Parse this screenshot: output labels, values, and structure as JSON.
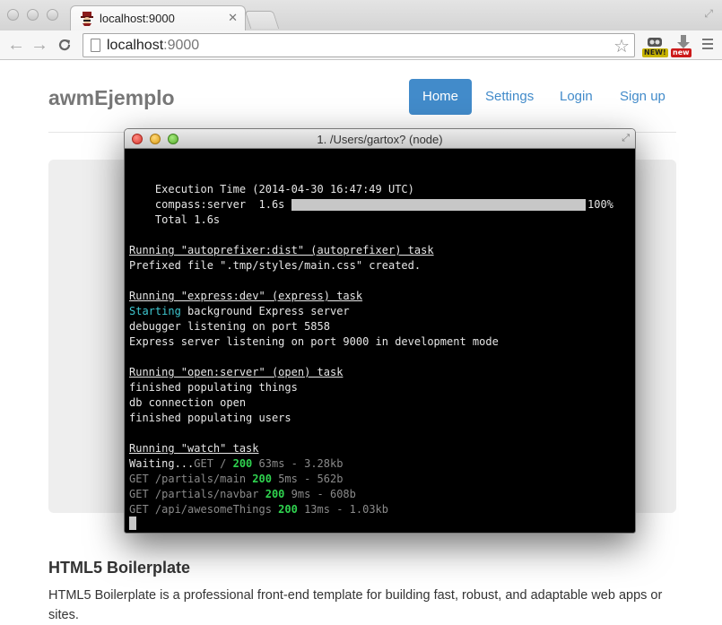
{
  "browser": {
    "tab_title": "localhost:9000",
    "tab_close": "✕",
    "url_host": "localhost",
    "url_port": ":9000",
    "extensions": [
      {
        "name": "ext-new-1",
        "badge": "NEW!",
        "color": "#c8b400"
      },
      {
        "name": "ext-new-2",
        "badge": "new",
        "color": "#cc1a1a"
      }
    ]
  },
  "site": {
    "brand": "awmEjemplo",
    "nav": [
      "Home",
      "Settings",
      "Login",
      "Sign up"
    ],
    "active_nav": "Home",
    "heading": "HTML5 Boilerplate",
    "paragraph": "HTML5 Boilerplate is a professional front-end template for building fast, robust, and adaptable web apps or sites."
  },
  "terminal": {
    "title": "1. /Users/gartox? (node)",
    "exec_time": "    Execution Time (2014-04-30 16:47:49 UTC)",
    "compass_label": "    compass:server  1.6s",
    "compass_percent": "100%",
    "compass_progress": 1.0,
    "total": "    Total 1.6s",
    "task1_header": "Running \"autoprefixer:dist\" (autoprefixer) task",
    "task1_line": "Prefixed file \".tmp/styles/main.css\" created.",
    "task2_header": "Running \"express:dev\" (express) task",
    "task2_starting": "Starting",
    "task2_starting_rest": " background Express server",
    "task2_line2": "debugger listening on port 5858",
    "task2_line3": "Express server listening on port 9000 in development mode",
    "task3_header": "Running \"open:server\" (open) task",
    "task3_line1": "finished populating things",
    "task3_line2": "db connection open",
    "task3_line3": "finished populating users",
    "task4_header": "Running \"watch\" task",
    "waiting": "Waiting...",
    "requests": [
      {
        "req": "GET / ",
        "status": "200",
        "rest": " 63ms - 3.28kb"
      },
      {
        "req": "GET /partials/main ",
        "status": "200",
        "rest": " 5ms - 562b"
      },
      {
        "req": "GET /partials/navbar ",
        "status": "200",
        "rest": " 9ms - 608b"
      },
      {
        "req": "GET /api/awesomeThings ",
        "status": "200",
        "rest": " 13ms - 1.03kb"
      }
    ]
  }
}
